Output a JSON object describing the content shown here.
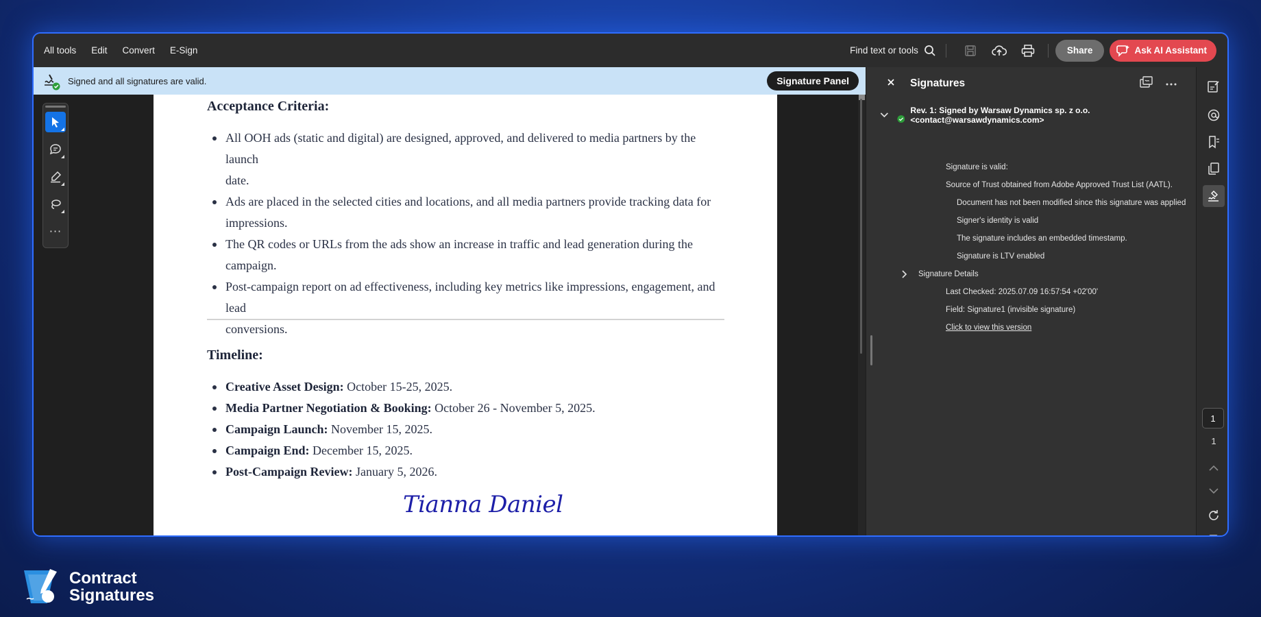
{
  "toolbar": {
    "menu": [
      "All tools",
      "Edit",
      "Convert",
      "E-Sign"
    ],
    "find_label": "Find text or tools",
    "share_label": "Share",
    "ai_label": "Ask AI Assistant"
  },
  "banner": {
    "text": "Signed and all signatures are valid.",
    "button": "Signature Panel"
  },
  "document": {
    "acceptance_heading": "Acceptance Criteria:",
    "acceptance_items": [
      [
        "All OOH ads (static and digital) are designed, approved, and delivered to media partners by the launch",
        "date."
      ],
      [
        "Ads are placed in the selected cities and locations, and all media partners provide tracking data for",
        "impressions."
      ],
      [
        "The QR codes or URLs from the ads show an increase in traffic and lead generation during the",
        "campaign."
      ],
      [
        "Post-campaign report on ad effectiveness, including key metrics like impressions, engagement, and lead",
        "conversions."
      ]
    ],
    "timeline_heading": "Timeline:",
    "timeline_items": [
      {
        "label": "Creative Asset Design:",
        "value": "October 15-25, 2025."
      },
      {
        "label": "Media Partner Negotiation & Booking:",
        "value": "October 26 - November 5, 2025."
      },
      {
        "label": "Campaign Launch:",
        "value": "November 15, 2025."
      },
      {
        "label": "Campaign End:",
        "value": "December 15, 2025."
      },
      {
        "label": "Post-Campaign Review:",
        "value": "January 5, 2026."
      }
    ],
    "signature": "Tianna Daniel"
  },
  "panel": {
    "title": "Signatures",
    "revision": "Rev. 1: Signed by Warsaw Dynamics sp. z o.o. <contact@warsawdynamics.com>",
    "valid": "Signature is valid:",
    "trust": "Source of Trust obtained from Adobe Approved Trust List (AATL).",
    "not_modified": "Document has not been modified since this signature was applied",
    "identity": "Signer's identity is valid",
    "timestamp": "The signature includes an embedded timestamp.",
    "ltv": "Signature is LTV enabled",
    "details": "Signature Details",
    "last_checked": "Last Checked: 2025.07.09 16:57:54 +02'00'",
    "field": "Field: Signature1 (invisible signature)",
    "view_version": "Click to view this version"
  },
  "pager": {
    "current": "1",
    "total": "1"
  },
  "brand": {
    "line1": "Contract",
    "line2": "Signatures"
  },
  "colors": {
    "accent_red": "#e34850",
    "accent_blue": "#1473e6",
    "valid_green": "#2d9d3a",
    "window_border": "#2f6dff"
  }
}
